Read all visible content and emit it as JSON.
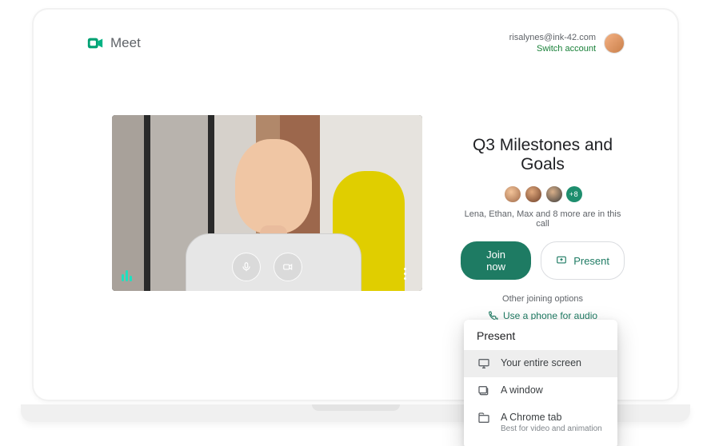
{
  "header": {
    "product": "Meet",
    "account_email": "risalynes@ink-42.com",
    "switch_label": "Switch account"
  },
  "meeting": {
    "title": "Q3 Milestones and Goals",
    "extra_count": "+8",
    "participants_line": "Lena, Ethan, Max and 8 more are in this call",
    "join_label": "Join now",
    "present_label": "Present",
    "other_options_label": "Other joining options",
    "phone_link": "Use a phone for audio"
  },
  "present_menu": {
    "title": "Present",
    "options": [
      {
        "label": "Your entire screen",
        "sub": ""
      },
      {
        "label": "A window",
        "sub": ""
      },
      {
        "label": "A Chrome tab",
        "sub": "Best for video and animation"
      }
    ]
  }
}
